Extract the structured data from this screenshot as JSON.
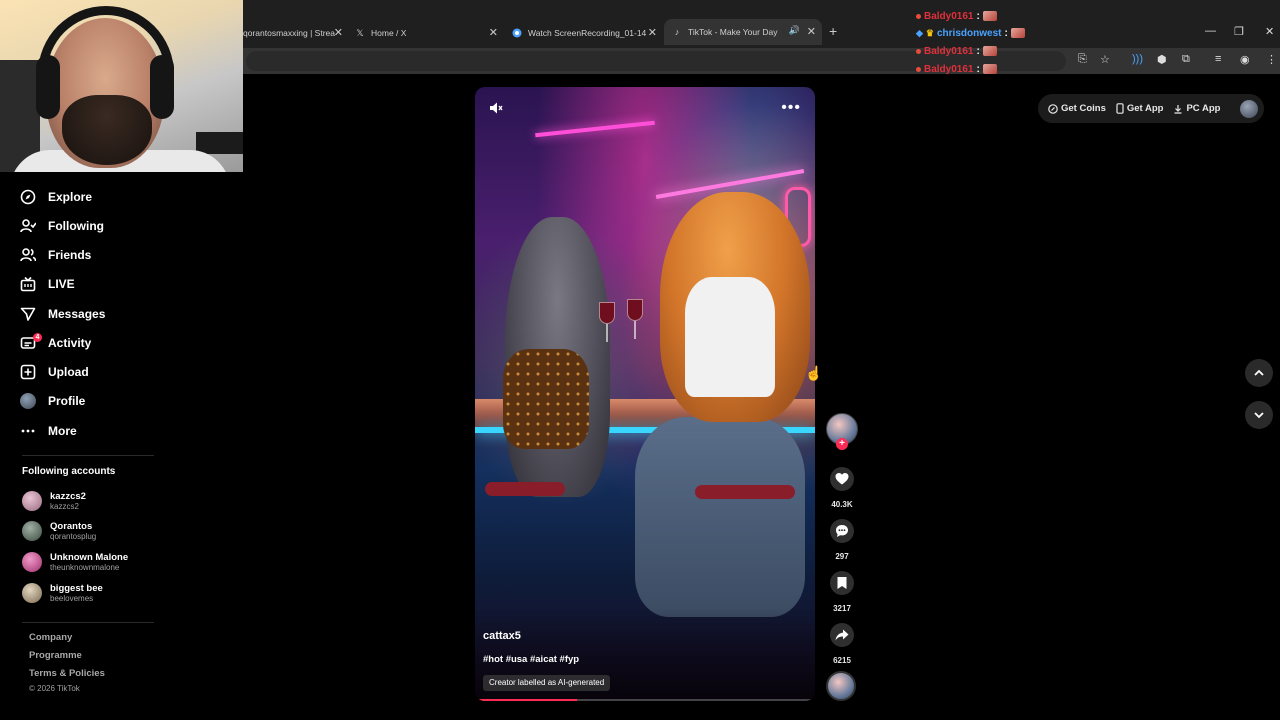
{
  "browser": {
    "tabs": [
      {
        "label": "qorantosmaxxing | Strea",
        "active": false
      },
      {
        "label": "Home / X",
        "icon": "x-logo-icon",
        "active": false
      },
      {
        "label": "Watch ScreenRecording_01-14",
        "icon": "globe-icon",
        "active": false
      },
      {
        "label": "TikTok - Make Your Day",
        "icon": "tiktok-icon",
        "active": true
      }
    ],
    "new_tab": "+",
    "close_glyph": "✕"
  },
  "chat": {
    "lines": [
      {
        "user": "Baldy0161",
        "color": "#e0303b"
      },
      {
        "user": "chrisdonwest",
        "color": "#4aa3ff"
      },
      {
        "user": "Baldy0161",
        "color": "#e0303b"
      },
      {
        "user": "Baldy0161",
        "color": "#e0303b"
      }
    ],
    "separator": ":"
  },
  "sidebar": {
    "nav": [
      {
        "label": "Explore",
        "icon": "compass-icon"
      },
      {
        "label": "Following",
        "icon": "following-icon"
      },
      {
        "label": "Friends",
        "icon": "friends-icon"
      },
      {
        "label": "LIVE",
        "icon": "live-icon"
      },
      {
        "label": "Messages",
        "icon": "messages-icon"
      },
      {
        "label": "Activity",
        "icon": "activity-icon",
        "badge": "4"
      },
      {
        "label": "Upload",
        "icon": "upload-icon"
      },
      {
        "label": "Profile",
        "icon": "profile-avatar"
      },
      {
        "label": "More",
        "icon": "more-icon"
      }
    ],
    "following_heading": "Following accounts",
    "following": [
      {
        "name": "kazzcs2",
        "handle": "kazzcs2",
        "color": "#c9a0b8"
      },
      {
        "name": "Qorantos",
        "handle": "qorantosplug",
        "color": "#5a6a5e"
      },
      {
        "name": "Unknown Malone",
        "handle": "theunknownmalone",
        "color": "#d86aa8"
      },
      {
        "name": "biggest bee",
        "handle": "beelovemes",
        "color": "#b8a890"
      }
    ],
    "footer": [
      "Company",
      "Programme",
      "Terms & Policies"
    ],
    "copyright": "© 2026 TikTok"
  },
  "video": {
    "username": "cattax5",
    "tags": "#hot #usa #aicat #fyp",
    "ai_label": "Creator labelled as AI-generated",
    "progress": 0.3
  },
  "actions": {
    "likes": "40.3K",
    "comments": "297",
    "saves": "3217",
    "shares": "6215"
  },
  "topbar": {
    "get_coins": "Get Coins",
    "get_app": "Get App",
    "pc_app": "PC App"
  },
  "colors": {
    "accent": "#fe2c55",
    "background": "#000000"
  }
}
